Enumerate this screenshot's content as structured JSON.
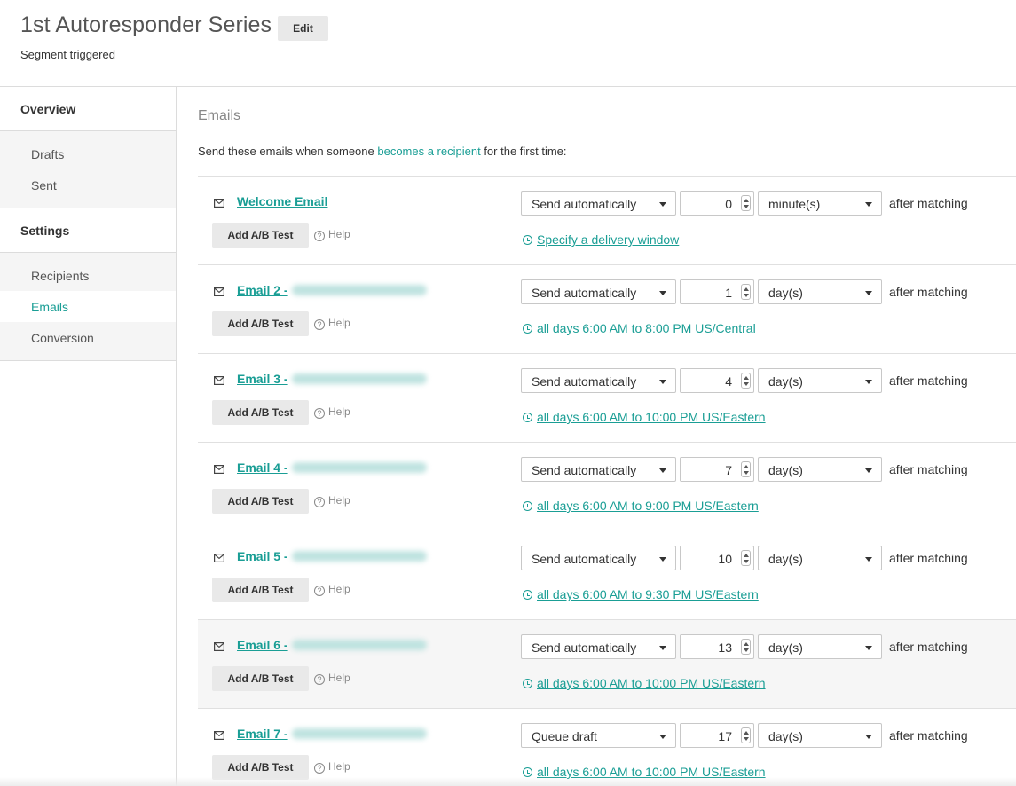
{
  "header": {
    "title": "1st Autoresponder Series",
    "edit_label": "Edit",
    "subtitle": "Segment triggered"
  },
  "sidebar": {
    "overview": "Overview",
    "overview_items": [
      "Drafts",
      "Sent"
    ],
    "settings": "Settings",
    "settings_items": [
      "Recipients",
      "Emails",
      "Conversion"
    ],
    "active_item": "Emails"
  },
  "main": {
    "heading": "Emails",
    "intro_before": "Send these emails when someone ",
    "intro_link": "becomes a recipient",
    "intro_after": " for the first time:",
    "ab_label": "Add A/B Test",
    "help_label": "Help",
    "after_label": "after matching",
    "emails": [
      {
        "name": "Welcome Email",
        "mode": "Send automatically",
        "amount": "0",
        "unit": "minute(s)",
        "window": "Specify a delivery window"
      },
      {
        "name": "Email 2 -",
        "mode": "Send automatically",
        "amount": "1",
        "unit": "day(s)",
        "window": "all days 6:00 AM to 8:00 PM US/Central"
      },
      {
        "name": "Email 3 -",
        "mode": "Send automatically",
        "amount": "4",
        "unit": "day(s)",
        "window": "all days 6:00 AM to 10:00 PM US/Eastern"
      },
      {
        "name": "Email 4 -",
        "mode": "Send automatically",
        "amount": "7",
        "unit": "day(s)",
        "window": "all days 6:00 AM to 9:00 PM US/Eastern"
      },
      {
        "name": "Email 5 -",
        "mode": "Send automatically",
        "amount": "10",
        "unit": "day(s)",
        "window": "all days 6:00 AM to 9:30 PM US/Eastern"
      },
      {
        "name": "Email 6 -",
        "mode": "Send automatically",
        "amount": "13",
        "unit": "day(s)",
        "window": "all days 6:00 AM to 10:00 PM US/Eastern"
      },
      {
        "name": "Email 7 -",
        "mode": "Queue draft",
        "amount": "17",
        "unit": "day(s)",
        "window": "all days 6:00 AM to 10:00 PM US/Eastern"
      }
    ]
  },
  "colors": {
    "accent": "#1a9e95"
  },
  "icons": {
    "email": "envelope-icon",
    "help": "question-circle-icon",
    "window": "clock-icon"
  }
}
